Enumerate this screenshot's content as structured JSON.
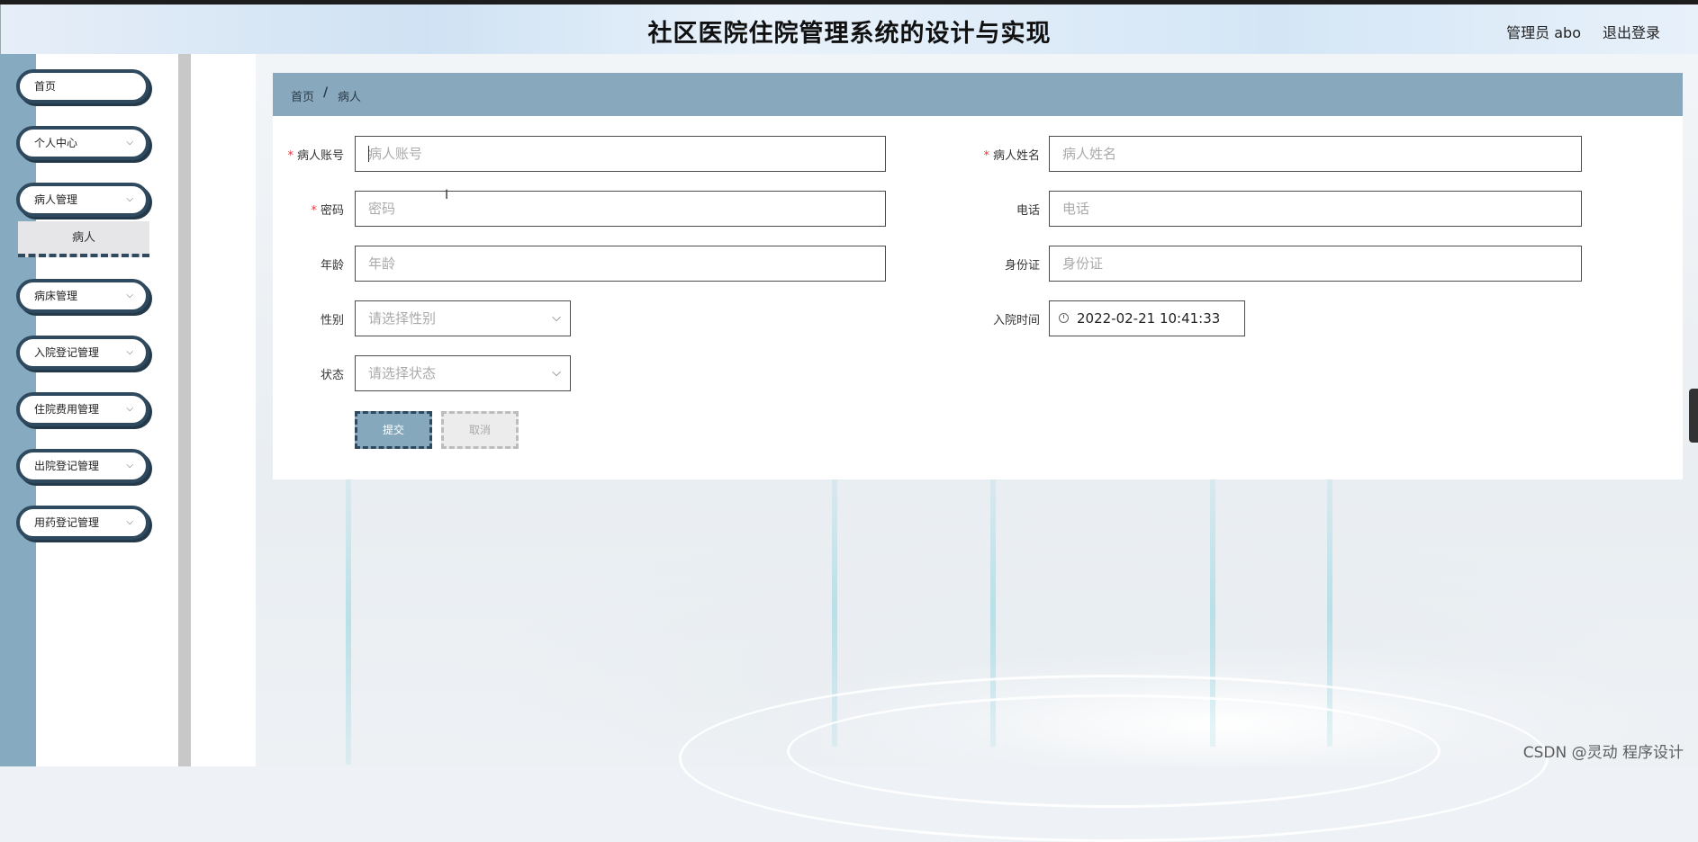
{
  "header": {
    "title": "社区医院住院管理系统的设计与实现",
    "user": "管理员 abo",
    "logout": "退出登录"
  },
  "sidebar": {
    "items": [
      {
        "label": "首页",
        "has_arrow": false
      },
      {
        "label": "个人中心",
        "has_arrow": true
      },
      {
        "label": "病人管理",
        "has_arrow": true
      },
      {
        "label": "病床管理",
        "has_arrow": true
      },
      {
        "label": "入院登记管理",
        "has_arrow": true
      },
      {
        "label": "住院费用管理",
        "has_arrow": true
      },
      {
        "label": "出院登记管理",
        "has_arrow": true
      },
      {
        "label": "用药登记管理",
        "has_arrow": true
      }
    ],
    "subitem": "病人"
  },
  "breadcrumb": {
    "home": "首页",
    "separator": "/",
    "current": "病人"
  },
  "form": {
    "account": {
      "label": "病人账号",
      "placeholder": "病人账号",
      "required": true
    },
    "name": {
      "label": "病人姓名",
      "placeholder": "病人姓名",
      "required": true
    },
    "password": {
      "label": "密码",
      "placeholder": "密码",
      "required": true
    },
    "phone": {
      "label": "电话",
      "placeholder": "电话",
      "required": false
    },
    "age": {
      "label": "年龄",
      "placeholder": "年龄",
      "required": false
    },
    "idcard": {
      "label": "身份证",
      "placeholder": "身份证",
      "required": false
    },
    "gender": {
      "label": "性别",
      "placeholder": "请选择性别"
    },
    "admit_time": {
      "label": "入院时间",
      "value": "2022-02-21 10:41:33"
    },
    "status": {
      "label": "状态",
      "placeholder": "请选择状态"
    },
    "submit": "提交",
    "cancel": "取消",
    "required_mark": "*"
  },
  "watermark": "CSDN @灵动 程序设计",
  "colors": {
    "accent": "#88a9bd",
    "sidebar_dark": "#2f4a5e",
    "required": "#e23b3b"
  }
}
